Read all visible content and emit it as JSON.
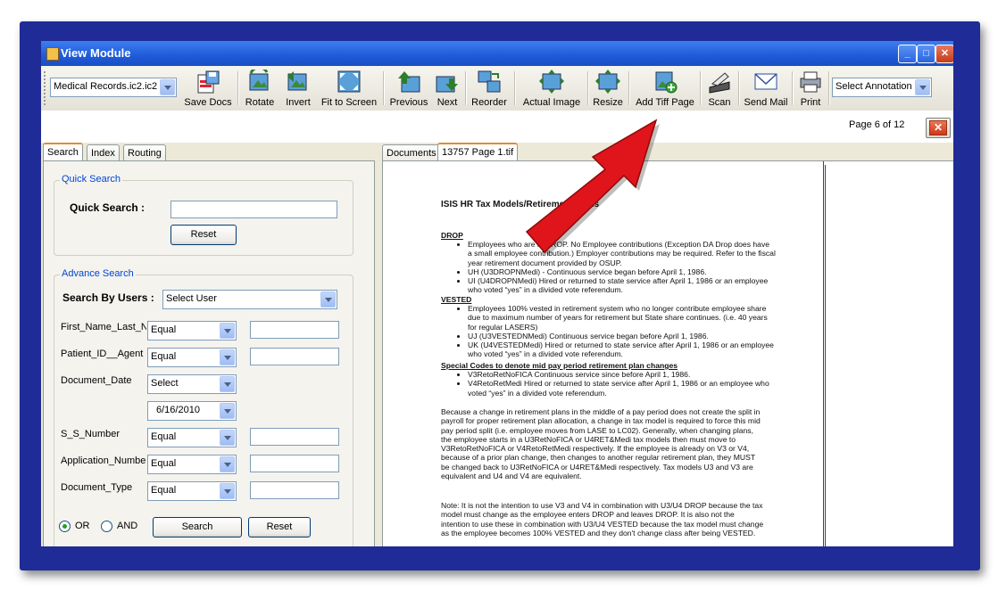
{
  "window": {
    "title": "View Module"
  },
  "toolbar": {
    "document_select": "Medical Records.ic2.ic2",
    "buttons": [
      {
        "id": "save-docs",
        "label": "Save Docs"
      },
      {
        "id": "rotate",
        "label": "Rotate"
      },
      {
        "id": "invert",
        "label": "Invert"
      },
      {
        "id": "fit-to-screen",
        "label": "Fit to Screen"
      },
      {
        "id": "previous",
        "label": "Previous"
      },
      {
        "id": "next",
        "label": "Next"
      },
      {
        "id": "reorder",
        "label": "Reorder"
      },
      {
        "id": "actual-image",
        "label": "Actual Image"
      },
      {
        "id": "resize",
        "label": "Resize"
      },
      {
        "id": "add-tiff-page",
        "label": "Add Tiff Page"
      },
      {
        "id": "scan",
        "label": "Scan"
      },
      {
        "id": "send-mail",
        "label": "Send Mail"
      },
      {
        "id": "print",
        "label": "Print"
      }
    ],
    "annotation_select": "Select Annotation"
  },
  "page_indicator": "Page 6 of 12",
  "left_tabs": [
    "Search",
    "Index",
    "Routing"
  ],
  "quick_search": {
    "legend": "Quick Search",
    "label": "Quick Search :",
    "value": "",
    "reset": "Reset"
  },
  "advance_search": {
    "legend": "Advance Search",
    "users_label": "Search By Users :",
    "users_select": "Select User",
    "fields": [
      {
        "name": "First_Name_Last_N",
        "op": "Equal",
        "value": ""
      },
      {
        "name": "Patient_ID__Agent",
        "op": "Equal",
        "value": ""
      },
      {
        "name": "Document_Date",
        "op": "Select",
        "date": "6/16/2010"
      },
      {
        "name": "S_S_Number",
        "op": "Equal",
        "value": ""
      },
      {
        "name": "Application_Numbe",
        "op": "Equal",
        "value": ""
      },
      {
        "name": "Document_Type",
        "op": "Equal",
        "value": ""
      }
    ],
    "or_label": "OR",
    "and_label": "AND",
    "search": "Search",
    "reset": "Reset"
  },
  "doc_tabs": [
    "Documents",
    "13757 Page 1.tif"
  ],
  "document": {
    "title": "ISIS HR Tax Models/Retirement Plans",
    "drop_heading": "DROP",
    "drop_items": [
      "Employees who are in DROP.  No Employee contributions (Exception DA Drop does have a small employee contribution.)  Employer contributions may be required.  Refer to the fiscal year retirement document provided by OSUP.",
      "UH (U3DROPNMedi) - Continuous service began before April 1, 1986.",
      "UI (U4DROPNMedi) Hired or returned to state service after April 1, 1986 or an employee who voted “yes” in a divided vote referendum."
    ],
    "vested_heading": "VESTED",
    "vested_items": [
      "Employees 100% vested in retirement system who no longer contribute employee share due to maximum number of years for retirement but State share continues. (i.e. 40 years for regular LASERS)",
      "UJ (U3VESTEDNMedi) Continuous service began before April 1, 1986.",
      "UK (U4VESTEDMedi) Hired or returned to state service after April 1, 1986 or an employee who voted “yes” in a divided vote referendum."
    ],
    "special_heading": "Special Codes to denote mid pay period retirement plan changes",
    "special_items": [
      "V3RetoRetNoFICA Continuous service since before April 1, 1986.",
      "V4RetoRetMedi Hired or returned to state service after April 1, 1986 or an employee who voted “yes” in a divided vote referendum."
    ],
    "paragraph1": "Because a change in retirement plans in the middle of a pay period does not create the split in payroll for proper retirement plan allocation, a change in tax model is required to force this mid pay period split (i.e. employee moves from LASE to LC02). Generally, when changing plans, the employee starts in a U3RetNoFICA or U4RET&Medi tax models then must move to V3RetoRetNoFICA or V4RetoRetMedi respectively. If the employee is already on V3 or V4, because of a prior plan change, then changes to another regular retirement plan, they MUST be changed back to U3RetNoFICA or U4RET&Medi respectively. Tax models U3 and V3 are equivalent and U4 and V4 are equivalent.",
    "paragraph2": "Note: It is not the intention to use V3 and V4 in combination with U3/U4 DROP because the tax model must change as the employee enters DROP and leaves DROP.  It is also not the intention to use these in combination with U3/U4 VESTED because the tax model must change as the employee becomes 100% VESTED and they don't change class after being VESTED."
  },
  "colors": {
    "frame": "#1f2b96",
    "titlebar": "#2a63dd",
    "arrow": "#e0141b",
    "legend": "#0046d5"
  }
}
